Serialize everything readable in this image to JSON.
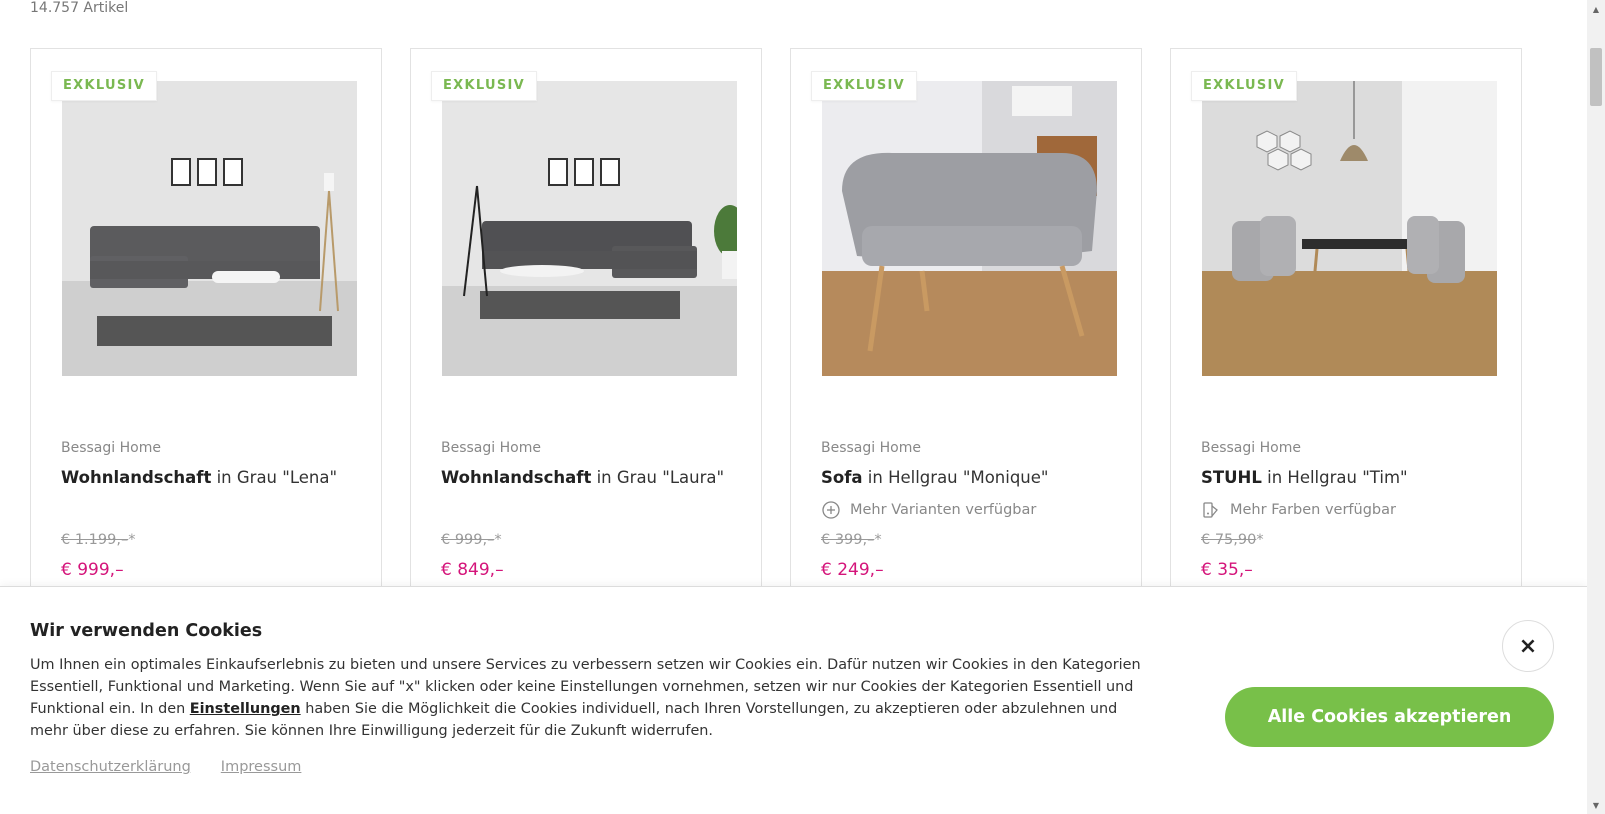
{
  "listing": {
    "count_label": "14.757 Artikel"
  },
  "products": [
    {
      "badge": "EXKLUSIV",
      "brand": "Bessagi Home",
      "name": "Wohnlandschaft",
      "name_suffix": " in Grau \"Lena\"",
      "variants": "",
      "old_price": "€ 1.199,–",
      "old_price_mark": "*",
      "price": "€ 999,–"
    },
    {
      "badge": "EXKLUSIV",
      "brand": "Bessagi Home",
      "name": "Wohnlandschaft",
      "name_suffix": " in Grau \"Laura\"",
      "variants": "",
      "old_price": "€ 999,–",
      "old_price_mark": "*",
      "price": "€ 849,–"
    },
    {
      "badge": "EXKLUSIV",
      "brand": "Bessagi Home",
      "name": "Sofa",
      "name_suffix": " in Hellgrau \"Monique\"",
      "variants": "Mehr Varianten verfügbar",
      "variants_icon": "plus-circle-icon",
      "old_price": "€ 399,–",
      "old_price_mark": "*",
      "price": "€ 249,–"
    },
    {
      "badge": "EXKLUSIV",
      "brand": "Bessagi Home",
      "name": "STUHL",
      "name_suffix": " in Hellgrau \"Tim\"",
      "variants": "Mehr Farben verfügbar",
      "variants_icon": "color-swatch-icon",
      "old_price": "€ 75,90",
      "old_price_mark": "*",
      "price": "€ 35,–"
    }
  ],
  "cookie": {
    "title": "Wir verwenden Cookies",
    "text_before_link": "Um Ihnen ein optimales Einkaufserlebnis zu bieten und unsere Services zu verbessern setzen wir Cookies ein. Dafür nutzen wir Cookies in den Kategorien Essentiell, Funktional und Marketing. Wenn Sie auf \"x\" klicken oder keine Einstellungen vornehmen, setzen wir nur Cookies der Kategorien Essentiell und Funktional ein. In den ",
    "settings_link": "Einstellungen",
    "text_after_link": " haben Sie die Möglichkeit die Cookies individuell, nach Ihren Vorstellungen, zu akzeptieren oder abzulehnen und mehr über diese zu erfahren. Sie können Ihre Einwilligung jederzeit für die Zukunft widerrufen.",
    "privacy_link": "Datenschutzerklärung",
    "imprint_link": "Impressum",
    "close_label": "×",
    "accept_label": "Alle Cookies akzeptieren"
  },
  "colors": {
    "badge_green": "#7ab851",
    "price_pink": "#d4147a",
    "accept_green": "#78c049"
  }
}
